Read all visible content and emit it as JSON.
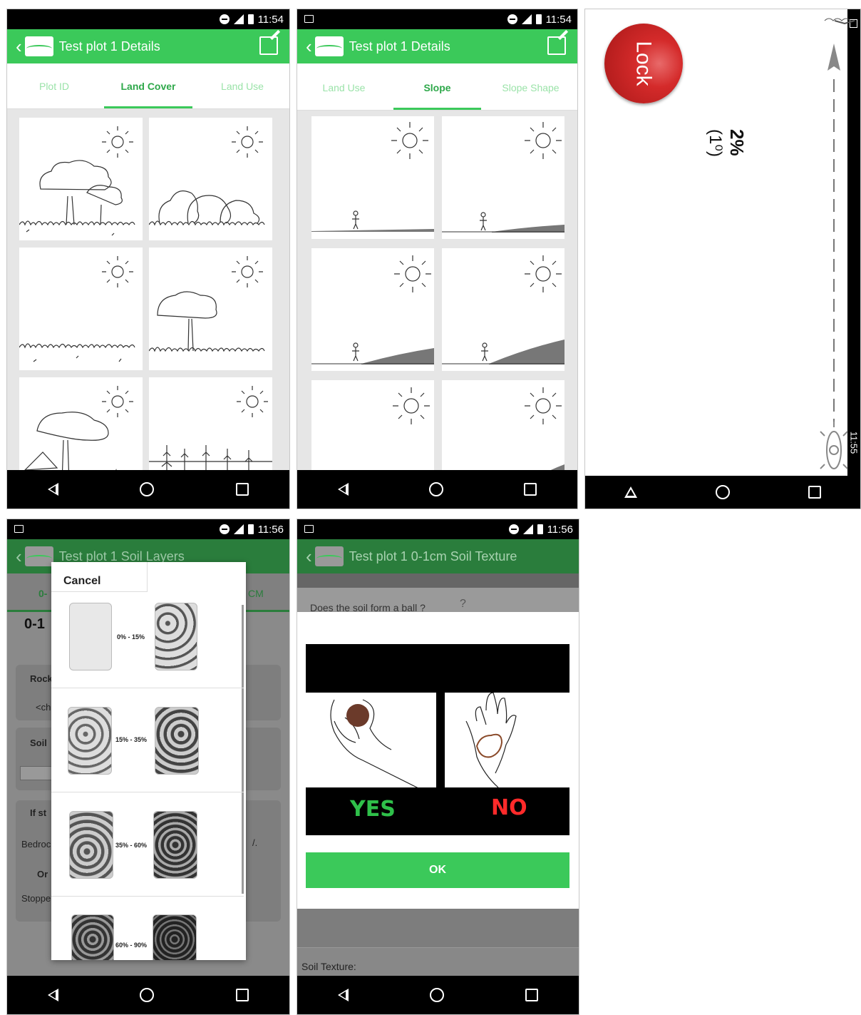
{
  "status": {
    "p1_time": "11:54",
    "p2_time": "11:54",
    "p3_time": "11:55",
    "p4_time": "11:56",
    "p5_time": "11:56"
  },
  "panel1": {
    "title": "Test plot 1 Details",
    "tabs": [
      {
        "label": "Plot ID",
        "active": false
      },
      {
        "label": "Land Cover",
        "active": true
      },
      {
        "label": "Land Use",
        "active": false
      }
    ]
  },
  "panel2": {
    "title": "Test plot 1 Details",
    "tabs": [
      {
        "label": "Land Use",
        "active": false
      },
      {
        "label": "Slope",
        "active": true
      },
      {
        "label": "Slope Shape",
        "active": false
      }
    ]
  },
  "panel3": {
    "lock_label": "Lock",
    "percent": "2%",
    "degrees": "(1⁰)"
  },
  "panel4": {
    "title": "Test plot 1 Soil Layers",
    "cancel_label": "Cancel",
    "options": [
      "0% - 15%",
      "15% - 35%",
      "35% - 60%",
      "60% - 90%"
    ],
    "bg_tab_fragment": "0-",
    "bg_tab_fragment_right": "CM",
    "bg_heading": "0-1",
    "bg_rows": [
      "Rock",
      "<ch",
      "Soil",
      "If st",
      "Bedroc",
      "Or",
      "Stoppe"
    ]
  },
  "panel5": {
    "title": "Test plot 1 0-1cm Soil Texture",
    "question": "Does the soil form a ball ?",
    "yes_label": "YES",
    "no_label": "NO",
    "ok_label": "OK",
    "footer_label": "Soil Texture:"
  },
  "colors": {
    "green": "#3bc95a",
    "red_lock": "#d42a2a",
    "yes_green": "#2fc04a",
    "no_red": "#ff2a2a"
  }
}
